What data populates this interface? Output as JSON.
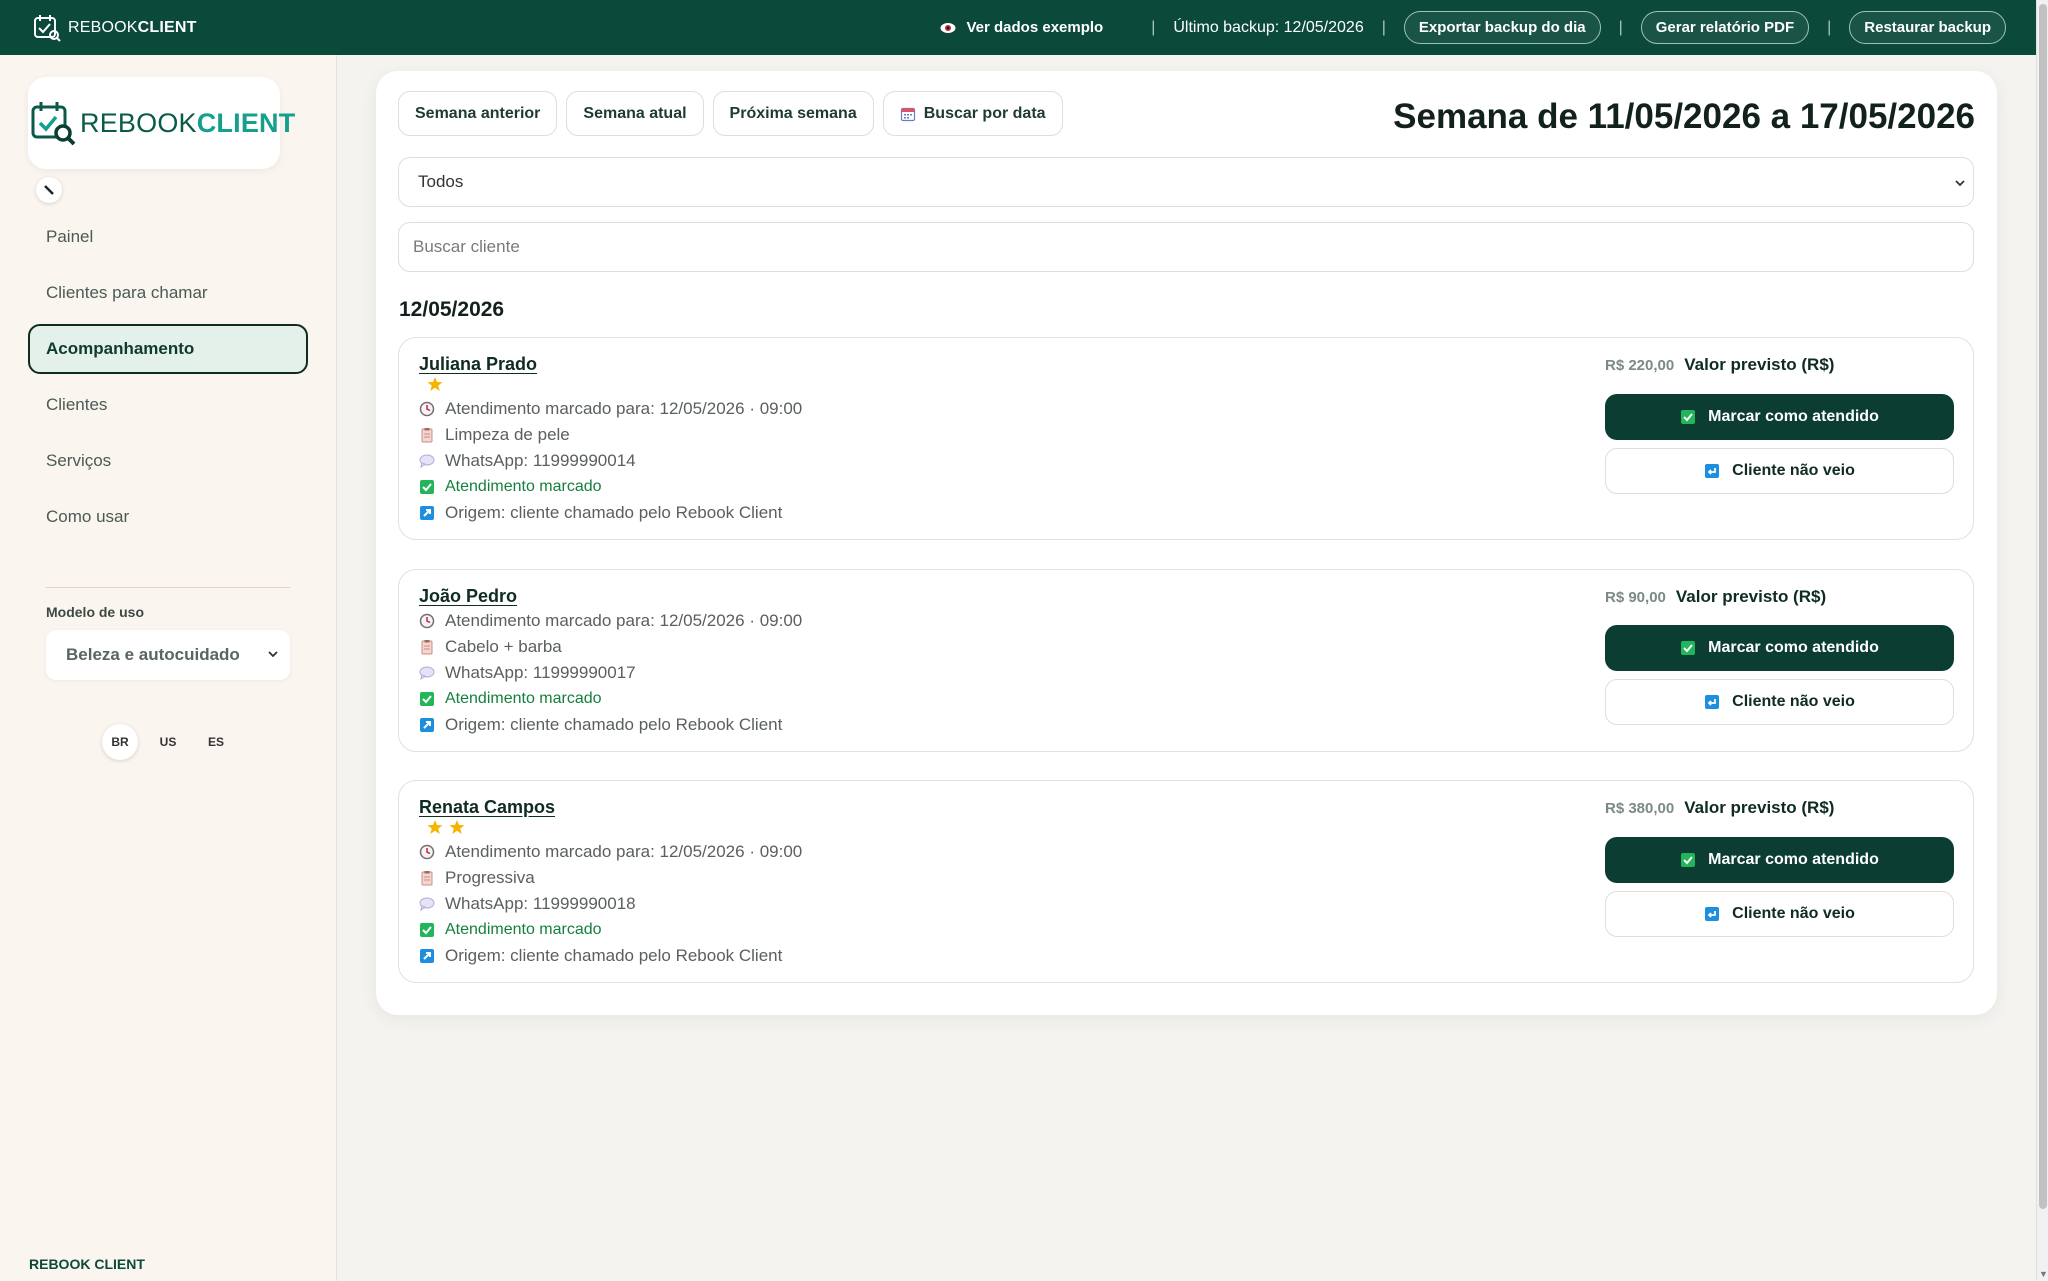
{
  "topbar": {
    "brand_prefix": "REBOOK",
    "brand_bold": "CLIENT",
    "demo_label": "Ver dados exemplo",
    "backup_status": "Último backup: 12/05/2026",
    "export_button": "Exportar backup do dia",
    "pdf_button": "Gerar relatório PDF",
    "restore_button": "Restaurar backup",
    "separator": "|"
  },
  "sidebar": {
    "logo_prefix": "REBOOK",
    "logo_bold": "CLIENT",
    "nav": [
      {
        "label": "Painel",
        "active": false
      },
      {
        "label": "Clientes para chamar",
        "active": false
      },
      {
        "label": "Acompanhamento",
        "active": true
      },
      {
        "label": "Clientes",
        "active": false
      },
      {
        "label": "Serviços",
        "active": false
      },
      {
        "label": "Como usar",
        "active": false
      }
    ],
    "model_label": "Modelo de uso",
    "model_value": "Beleza e autocuidado",
    "languages": [
      "BR",
      "US",
      "ES"
    ],
    "active_language": "BR",
    "footer": "REBOOK CLIENT"
  },
  "main": {
    "week_buttons": {
      "prev": "Semana anterior",
      "current": "Semana atual",
      "next": "Próxima semana",
      "search_date": "Buscar por data"
    },
    "week_title": "Semana de 11/05/2026 a 17/05/2026",
    "filter_value": "Todos",
    "search_placeholder": "Buscar cliente",
    "date_heading": "12/05/2026",
    "cards": [
      {
        "name": "Juliana Prado",
        "stars": 1,
        "appointment": "Atendimento marcado para: 12/05/2026 · 09:00",
        "service": "Limpeza de pele",
        "whatsapp": "WhatsApp: 11999990014",
        "status": "Atendimento marcado",
        "origin": "Origem: cliente chamado pelo Rebook Client",
        "amount": "R$ 220,00",
        "amount_label": "Valor previsto (R$)",
        "done_button": "Marcar como atendido",
        "noshow_button": "Cliente não veio"
      },
      {
        "name": "João Pedro",
        "stars": 0,
        "appointment": "Atendimento marcado para: 12/05/2026 · 09:00",
        "service": "Cabelo + barba",
        "whatsapp": "WhatsApp: 11999990017",
        "status": "Atendimento marcado",
        "origin": "Origem: cliente chamado pelo Rebook Client",
        "amount": "R$ 90,00",
        "amount_label": "Valor previsto (R$)",
        "done_button": "Marcar como atendido",
        "noshow_button": "Cliente não veio"
      },
      {
        "name": "Renata Campos",
        "stars": 2,
        "appointment": "Atendimento marcado para: 12/05/2026 · 09:00",
        "service": "Progressiva",
        "whatsapp": "WhatsApp: 11999990018",
        "status": "Atendimento marcado",
        "origin": "Origem: cliente chamado pelo Rebook Client",
        "amount": "R$ 380,00",
        "amount_label": "Valor previsto (R$)",
        "done_button": "Marcar como atendido",
        "noshow_button": "Cliente não veio"
      }
    ]
  },
  "colors": {
    "primary": "#0b4a3b",
    "button_dark": "#0b3d33",
    "accent_teal": "#14a08d",
    "status_green": "#15803d",
    "star": "#f5b400",
    "sidebar_bg": "#fbf5ef"
  }
}
